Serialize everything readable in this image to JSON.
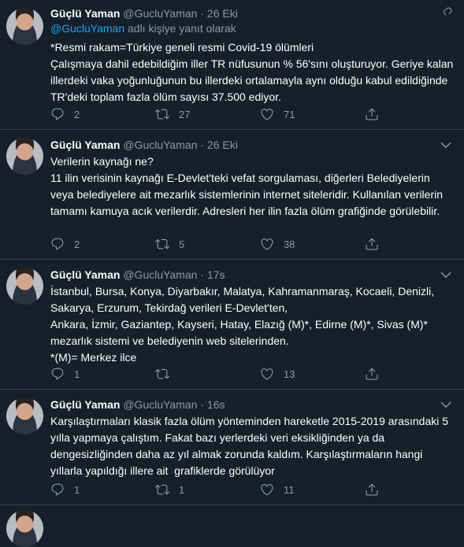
{
  "tweets": [
    {
      "name": "Güçlü Yaman",
      "handle": "@GucluYaman",
      "sep": "·",
      "time": "26 Eki",
      "reply_to_link": "@GucluYaman",
      "reply_to_suffix": "adlı kişiye yanıt olarak",
      "text": "*Resmi rakam=Türkiye geneli resmi Covid-19 ölümleri\nÇalışmaya dahil edebildiğim iller TR nüfusunun % 56'sını oluşturuyor. Geriye kalan illerdeki vaka yoğunluğunun bu illerdeki ortalamayla aynı olduğu kabul edildiğinde TR'deki toplam fazla ölüm sayısı 37.500 ediyor.",
      "replies": "2",
      "retweets": "27",
      "likes": "71"
    },
    {
      "name": "Güçlü Yaman",
      "handle": "@GucluYaman",
      "sep": "·",
      "time": "26 Eki",
      "text": "Verilerin kaynağı ne?\n11 ilin verisinin kaynağı E-Devlet'teki vefat sorgulaması, diğerleri Belediyelerin veya belediyelere ait mezarlık sistemlerinin internet siteleridir. Kullanılan verilerin tamamı kamuya acık verilerdir. Adresleri her ilin fazla ölüm grafiğinde görülebilir.",
      "replies": "2",
      "retweets": "5",
      "likes": "38"
    },
    {
      "name": "Güçlü Yaman",
      "handle": "@GucluYaman",
      "sep": "·",
      "time": "17s",
      "text": "İstanbul, Bursa, Konya, Diyarbakır, Malatya, Kahramanmaraş, Kocaeli, Denizli, Sakarya, Erzurum, Tekirdağ verileri E-Devlet'ten,\nAnkara, İzmir, Gaziantep, Kayseri, Hatay, Elazığ (M)*, Edirne (M)*, Sivas (M)* mezarlık sistemi ve belediyenin web sitelerinden.\n*(M)= Merkez ilce",
      "replies": "1",
      "retweets": "",
      "likes": "13"
    },
    {
      "name": "Güçlü Yaman",
      "handle": "@GucluYaman",
      "sep": "·",
      "time": "16s",
      "text": "Karşılaştırmaları klasik fazla ölüm yönteminden hareketle 2015-2019 arasındaki 5 yılla yapmaya çalıştım. Fakat bazı yerlerdeki veri eksikliğinden ya da dengesizliğinden daha az yıl almak zorunda kaldım. Karşılaştırmaların hangi yıllarla yapıldığı illere ait  grafiklerde görülüyor",
      "replies": "1",
      "retweets": "1",
      "likes": "11"
    }
  ]
}
